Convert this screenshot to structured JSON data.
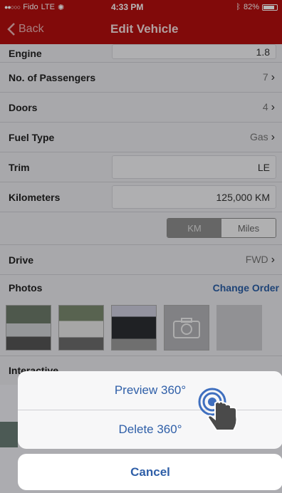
{
  "status_bar": {
    "carrier": "Fido",
    "network": "LTE",
    "time": "4:33 PM",
    "battery_text": "82%",
    "battery_level": 0.82
  },
  "nav": {
    "back_label": "Back",
    "title": "Edit Vehicle"
  },
  "form": {
    "engine": {
      "label": "Engine",
      "value": "1.8"
    },
    "passengers": {
      "label": "No. of Passengers",
      "value": "7"
    },
    "doors": {
      "label": "Doors",
      "value": "4"
    },
    "fuel": {
      "label": "Fuel Type",
      "value": "Gas"
    },
    "trim": {
      "label": "Trim",
      "value": "LE"
    },
    "kilometers": {
      "label": "Kilometers",
      "value": "125,000 KM"
    },
    "units": {
      "selected": "KM",
      "other": "Miles"
    },
    "drive": {
      "label": "Drive",
      "value": "FWD"
    },
    "photos": {
      "label": "Photos",
      "change_order": "Change Order"
    },
    "interactive": {
      "label": "Interactive"
    }
  },
  "action_sheet": {
    "preview": "Preview 360°",
    "delete": "Delete 360°",
    "cancel": "Cancel"
  },
  "colors": {
    "brand_red": "#b30f0f",
    "link_blue": "#2f5fa8"
  }
}
